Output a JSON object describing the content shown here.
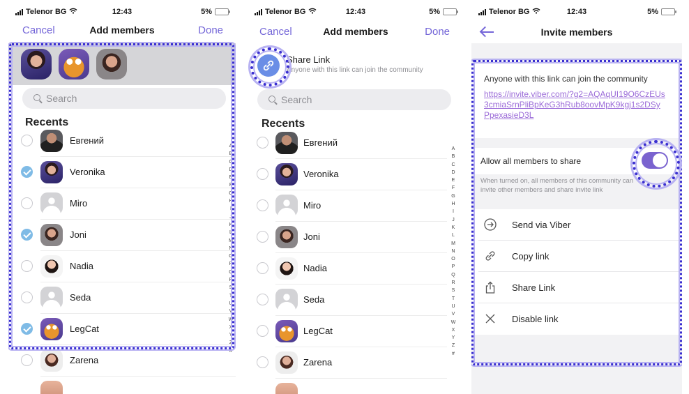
{
  "status": {
    "carrier": "Telenor BG",
    "time": "12:43",
    "battery": "5%"
  },
  "screen1": {
    "cancel": "Cancel",
    "title": "Add members",
    "done": "Done",
    "search_placeholder": "Search",
    "recents": "Recents",
    "contacts": [
      {
        "name": "Евгений",
        "checked": false
      },
      {
        "name": "Veronika",
        "checked": true
      },
      {
        "name": "Miro",
        "checked": false
      },
      {
        "name": "Joni",
        "checked": true
      },
      {
        "name": "Nadia",
        "checked": false
      },
      {
        "name": "Seda",
        "checked": false
      },
      {
        "name": "LegCat",
        "checked": true
      },
      {
        "name": "Zarena",
        "checked": false
      }
    ]
  },
  "screen2": {
    "cancel": "Cancel",
    "title": "Add members",
    "done": "Done",
    "share_link_title": "Share Link",
    "share_link_subtitle": "Anyone with this link can join the community",
    "search_placeholder": "Search",
    "recents": "Recents",
    "contacts": [
      "Евгений",
      "Veronika",
      "Miro",
      "Joni",
      "Nadia",
      "Seda",
      "LegCat",
      "Zarena"
    ]
  },
  "alphabet": [
    "A",
    "B",
    "C",
    "D",
    "E",
    "F",
    "G",
    "H",
    "I",
    "J",
    "K",
    "L",
    "M",
    "N",
    "O",
    "P",
    "Q",
    "R",
    "S",
    "T",
    "U",
    "V",
    "W",
    "X",
    "Y",
    "Z",
    "#"
  ],
  "screen3": {
    "title": "Invite members",
    "description": "Anyone with this link can join the community",
    "link": "https://invite.viber.com/?g2=AQAqUI19O6CzEUs3cmiaSrnPliBpKeG3hRub8oovMpK9kgj1s2DSyPpexasieD3L",
    "allow_label": "Allow all members to share",
    "allow_on": true,
    "allow_note": "When turned on, all members of this community can invite other members and share invite link",
    "actions": [
      {
        "label": "Send via Viber",
        "icon": "arrow-circle-right-icon"
      },
      {
        "label": "Copy link",
        "icon": "link-icon"
      },
      {
        "label": "Share Link",
        "icon": "share-icon"
      },
      {
        "label": "Disable link",
        "icon": "close-icon"
      }
    ]
  },
  "colors": {
    "accent": "#7466d8",
    "check": "#7fbbe6",
    "toggle": "#7a63cf",
    "highlight": "#3a2fd0",
    "link": "#9b6bd8"
  }
}
